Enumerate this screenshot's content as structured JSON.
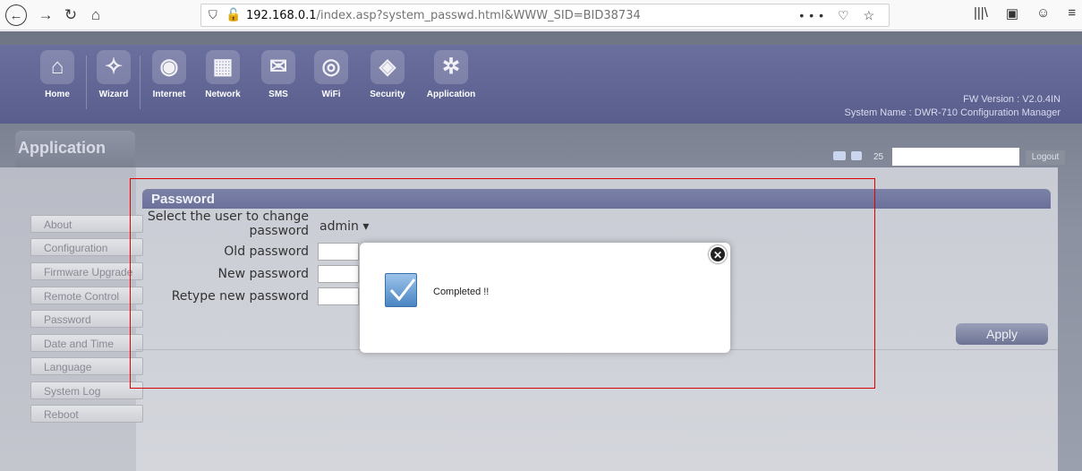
{
  "browser": {
    "back_icon": "←",
    "forward_icon": "→",
    "reload_icon": "↻",
    "home_icon": "⌂",
    "url_host": "192.168.0.1",
    "url_path": "/index.asp?system_passwd.html&WWW_SID=BID38734",
    "page_actions_icon": "•••",
    "pocket_icon": "♡",
    "bookmark_icon": "☆",
    "library_icon": "|||\\",
    "sidebar_icon": "▣",
    "account_icon": "☺",
    "menu_icon": "≡"
  },
  "topnav": {
    "items": [
      {
        "label": "Home",
        "icon": "⌂"
      },
      {
        "label": "Wizard",
        "icon": "✧"
      },
      {
        "label": "Internet",
        "icon": "◉"
      },
      {
        "label": "Network",
        "icon": "▦"
      },
      {
        "label": "SMS",
        "icon": "✉"
      },
      {
        "label": "WiFi",
        "icon": "◎"
      },
      {
        "label": "Security",
        "icon": "◈"
      },
      {
        "label": "Application",
        "icon": "✲"
      }
    ],
    "fw_version": "FW Version : V2.0.4IN",
    "system_name": "System Name : DWR-710 Configuration Manager"
  },
  "section": {
    "title": "Application"
  },
  "status": {
    "count": "25",
    "logout_label": "Logout"
  },
  "sidebar": {
    "items": [
      {
        "label": "About"
      },
      {
        "label": "Configuration"
      },
      {
        "label": "Firmware Upgrade"
      },
      {
        "label": "Remote Control"
      },
      {
        "label": "Password"
      },
      {
        "label": "Date and Time"
      },
      {
        "label": "Language"
      },
      {
        "label": "System Log"
      },
      {
        "label": "Reboot"
      }
    ]
  },
  "password_form": {
    "header": "Password",
    "select_user_label_line1": "Select the user to change",
    "select_user_label_line2": "password",
    "selected_user": "admin ▾",
    "old_password_label": "Old password",
    "new_password_label": "New password",
    "retype_password_label": "Retype new password",
    "apply_label": "Apply"
  },
  "modal": {
    "message": "Completed !!",
    "close_icon": "✕"
  },
  "colors": {
    "nav_bg": "#595e8d",
    "highlight_box": "#e00000",
    "apply_button": "#6d7394"
  }
}
